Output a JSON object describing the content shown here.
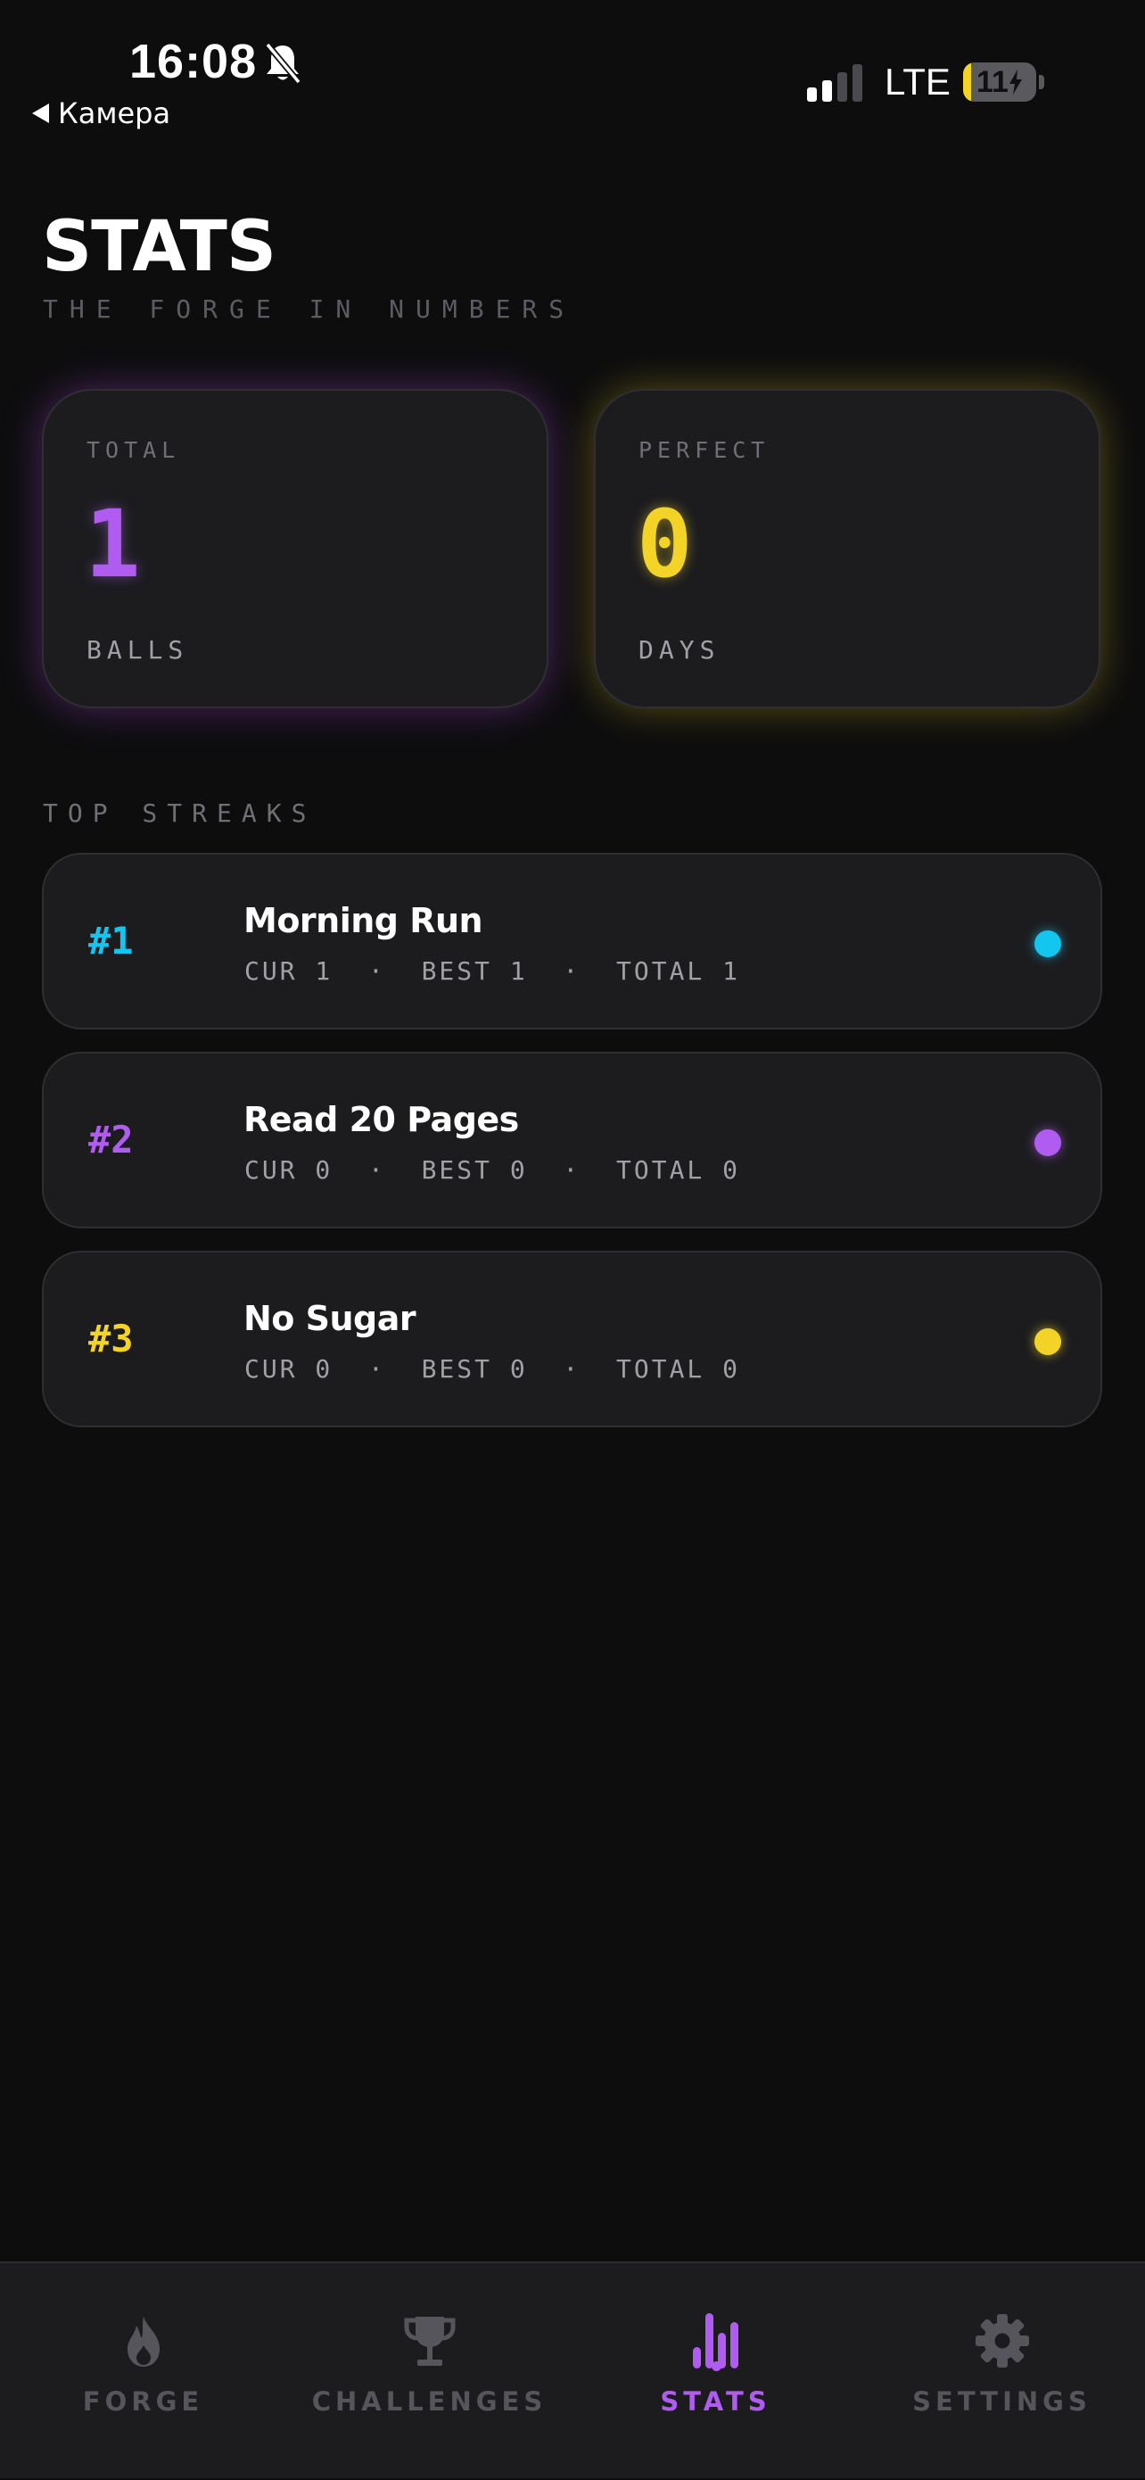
{
  "status_bar": {
    "time": "16:08",
    "back_label": "Камера",
    "network": "LTE",
    "battery": "11",
    "battery_level": 0.11,
    "battery_color": "#f4d327"
  },
  "header": {
    "title": "STATS",
    "subtitle": "THE FORGE IN NUMBERS"
  },
  "stat_cards": [
    {
      "label": "TOTAL",
      "value": "1",
      "unit": "BALLS",
      "color": "#b05cf0"
    },
    {
      "label": "PERFECT",
      "value": "0",
      "unit": "DAYS",
      "color": "#f4d327"
    }
  ],
  "top_streaks": {
    "label": "TOP STREAKS",
    "items": [
      {
        "rank": "#1",
        "name": "Morning Run",
        "meta": "CUR 1  ·  BEST 1  ·  TOTAL 1",
        "color": "#13c6ef"
      },
      {
        "rank": "#2",
        "name": "Read 20 Pages",
        "meta": "CUR 0  ·  BEST 0  ·  TOTAL 0",
        "color": "#b05cf0"
      },
      {
        "rank": "#3",
        "name": "No Sugar",
        "meta": "CUR 0  ·  BEST 0  ·  TOTAL 0",
        "color": "#f4d327"
      }
    ]
  },
  "tabs": [
    {
      "label": "FORGE",
      "icon": "flame-icon",
      "active": false
    },
    {
      "label": "CHALLENGES",
      "icon": "trophy-icon",
      "active": false
    },
    {
      "label": "STATS",
      "icon": "bar-chart-icon",
      "active": true
    },
    {
      "label": "SETTINGS",
      "icon": "gear-icon",
      "active": false
    }
  ],
  "colors": {
    "background": "#0d0d0e",
    "card": "#1c1c1f",
    "accent": "#b05cf0",
    "inactive": "#55555b"
  }
}
